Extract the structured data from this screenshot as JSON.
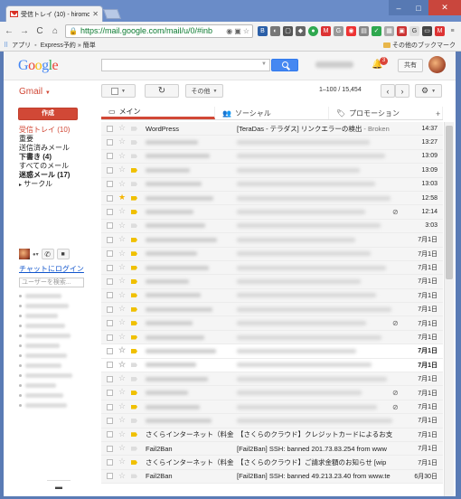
{
  "browser": {
    "tab_title": "受信トレイ (10) - hiromc",
    "url": "https://mail.google.com/mail/u/0/#inb",
    "bookmarks": [
      {
        "label": "アプリ"
      },
      {
        "label": "Express予約 » 簡単"
      }
    ],
    "other_bookmarks": "その他のブックマーク"
  },
  "header": {
    "logo": "Google",
    "notifications_count": "3",
    "share_label": "共有",
    "gmail_label": "Gmail"
  },
  "toolbar": {
    "more_label": "その他",
    "pagination": "1–100 / 15,454"
  },
  "sidebar": {
    "compose_label": "作成",
    "folders": [
      {
        "label": "受信トレイ (10)",
        "active": true
      },
      {
        "label": "重要"
      },
      {
        "label": "送信済みメール"
      },
      {
        "label": "下書き (4)",
        "bold": true
      },
      {
        "label": "すべてのメール"
      },
      {
        "label": "迷惑メール (17)",
        "bold": true
      },
      {
        "label": "サークル"
      }
    ],
    "chat_login": "チャットにログイン",
    "user_search_placeholder": "ユーザーを検索..."
  },
  "categories": [
    {
      "label": "メイン",
      "icon": "inbox-icon",
      "active": true
    },
    {
      "label": "ソーシャル",
      "icon": "people-icon"
    },
    {
      "label": "プロモーション",
      "icon": "tag-icon"
    }
  ],
  "emails": [
    {
      "sender": "WordPress",
      "subject": "[TeraDas - テラダス] リンクエラーの検出",
      "snippet": " - Broken",
      "date": "14:37",
      "starred": false,
      "important": false,
      "unread": false
    },
    {
      "sender": "",
      "subject": "",
      "date": "13:27",
      "important": false
    },
    {
      "sender": "",
      "subject": "",
      "date": "13:09",
      "important": false
    },
    {
      "sender": "",
      "subject": "",
      "date": "13:09",
      "important": true
    },
    {
      "sender": "",
      "subject": "",
      "date": "13:03",
      "important": false
    },
    {
      "sender": "",
      "subject": "",
      "date": "12:58",
      "important": true,
      "starred": true
    },
    {
      "sender": "",
      "subject": "",
      "date": "12:14",
      "important": true,
      "attachment": true
    },
    {
      "sender": "",
      "subject": "",
      "date": "3:03",
      "important": false
    },
    {
      "sender": "",
      "subject": "",
      "date": "7月1日",
      "important": true
    },
    {
      "sender": "",
      "subject": "",
      "date": "7月1日",
      "important": true
    },
    {
      "sender": "",
      "subject": "",
      "date": "7月1日",
      "important": true
    },
    {
      "sender": "",
      "subject": "",
      "date": "7月1日",
      "important": true
    },
    {
      "sender": "",
      "subject": "",
      "date": "7月1日",
      "important": true
    },
    {
      "sender": "",
      "subject": "",
      "date": "7月1日",
      "important": true
    },
    {
      "sender": "",
      "subject": "",
      "date": "7月1日",
      "important": true,
      "attachment": true
    },
    {
      "sender": "",
      "subject": "",
      "date": "7月1日",
      "important": true
    },
    {
      "sender": "",
      "subject": "",
      "date": "7月1日",
      "important": true,
      "unread": true
    },
    {
      "sender": "",
      "subject": "",
      "date": "7月1日",
      "important": false,
      "unread": true
    },
    {
      "sender": "",
      "subject": "",
      "date": "7月1日",
      "important": false
    },
    {
      "sender": "",
      "subject": "",
      "date": "7月1日",
      "important": true,
      "attachment": true
    },
    {
      "sender": "",
      "subject": "",
      "date": "7月1日",
      "important": true,
      "attachment": true
    },
    {
      "sender": "",
      "subject": "",
      "date": "7月1日",
      "important": false
    },
    {
      "sender": "さくらインターネット（料金",
      "subject": "【さくらのクラウド】クレジットカードによるお支",
      "snippet": "",
      "date": "7月1日",
      "important": true
    },
    {
      "sender": "Fail2Ban",
      "subject": "[Fail2Ban] SSH: banned 201.73.83.254 from www",
      "snippet": "",
      "date": "7月1日",
      "important": false
    },
    {
      "sender": "さくらインターネット（料金",
      "subject": "【さくらのクラウド】ご請求金額のお知らせ [wip",
      "snippet": "",
      "date": "7月1日",
      "important": true
    },
    {
      "sender": "Fail2Ban",
      "subject": "[Fail2Ban] SSH: banned 49.213.23.40 from www.te",
      "snippet": "",
      "date": "6月30日",
      "important": false
    }
  ]
}
